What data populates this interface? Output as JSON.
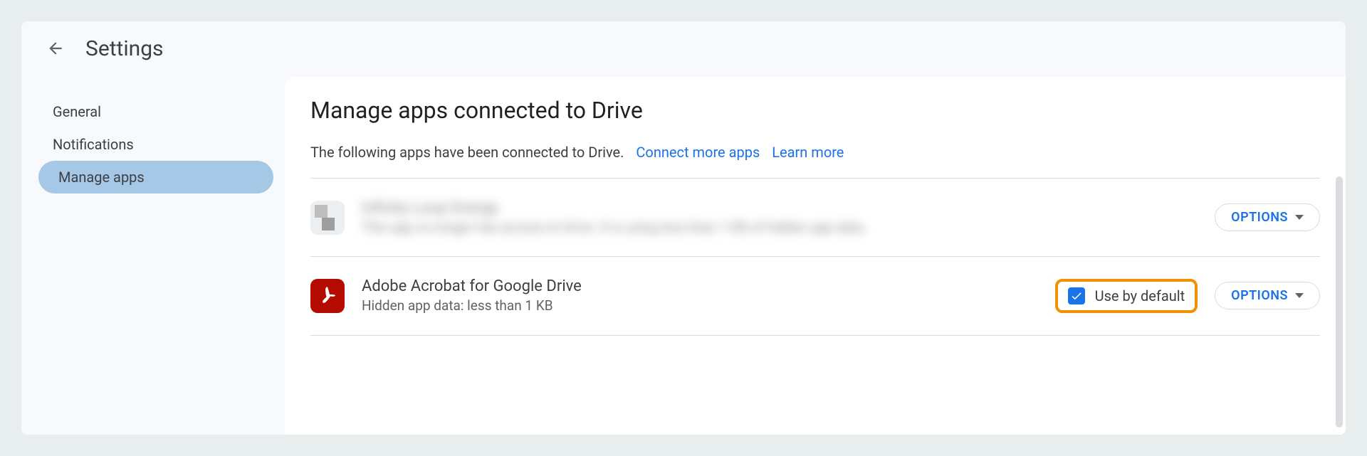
{
  "header": {
    "title": "Settings"
  },
  "sidebar": {
    "items": [
      {
        "label": "General",
        "active": false
      },
      {
        "label": "Notifications",
        "active": false
      },
      {
        "label": "Manage apps",
        "active": true
      }
    ]
  },
  "main": {
    "title": "Manage apps connected to Drive",
    "subtitle_text": "The following apps have been connected to Drive.",
    "connect_link": "Connect more apps",
    "learn_link": "Learn more",
    "options_label": "OPTIONS",
    "default_label": "Use by default",
    "apps": [
      {
        "name": "Infinity Loop Energy",
        "sub": "This app no longer has access to Drive. It is using less than 1 KB of hidden app data.",
        "blurred": true,
        "show_default": false,
        "default_checked": false
      },
      {
        "name": "Adobe Acrobat for Google Drive",
        "sub": "Hidden app data: less than 1 KB",
        "blurred": false,
        "show_default": true,
        "default_checked": true
      }
    ]
  }
}
